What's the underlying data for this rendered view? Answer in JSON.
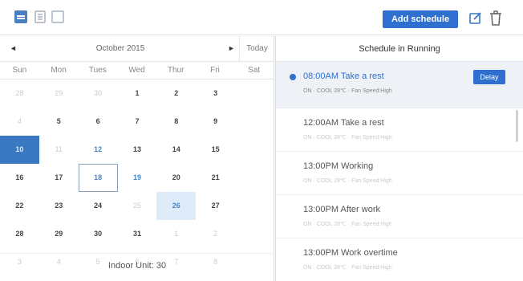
{
  "toolbar": {
    "icons": [
      "calendar-view-icon",
      "list-view-icon",
      "grid-view-icon",
      "edit-icon",
      "trash-icon"
    ],
    "add_schedule_label": "Add schedule"
  },
  "calendar": {
    "prev_symbol": "◄",
    "month_title": "October 2015",
    "next_symbol": "►",
    "today_label": "Today",
    "weekdays": [
      "Sun",
      "Mon",
      "Tues",
      "Wed",
      "Thur",
      "Fri",
      "Sat"
    ],
    "days": [
      {
        "n": "28",
        "other": true
      },
      {
        "n": "29",
        "other": true
      },
      {
        "n": "30",
        "other": true
      },
      {
        "n": "1"
      },
      {
        "n": "2"
      },
      {
        "n": "3"
      },
      {
        "n": "4",
        "other": true
      },
      {
        "n": "5"
      },
      {
        "n": "6"
      },
      {
        "n": "7"
      },
      {
        "n": "8"
      },
      {
        "n": "9"
      },
      {
        "n": "10",
        "selected": true
      },
      {
        "n": "11",
        "other": true
      },
      {
        "n": "12",
        "weekend": true
      },
      {
        "n": "13"
      },
      {
        "n": "14"
      },
      {
        "n": "15"
      },
      {
        "n": "16"
      },
      {
        "n": "17"
      },
      {
        "n": "18",
        "weekend": true,
        "today": true
      },
      {
        "n": "19",
        "weekend": true
      },
      {
        "n": "20"
      },
      {
        "n": "21"
      },
      {
        "n": "22"
      },
      {
        "n": "23"
      },
      {
        "n": "24"
      },
      {
        "n": "25",
        "other": true
      },
      {
        "n": "26",
        "highlight": true
      },
      {
        "n": "27"
      },
      {
        "n": "28"
      },
      {
        "n": "29"
      },
      {
        "n": "30"
      },
      {
        "n": "31"
      },
      {
        "n": "1",
        "other": true
      },
      {
        "n": "2",
        "other": true
      },
      {
        "n": "3",
        "other": true
      },
      {
        "n": "4",
        "other": true
      },
      {
        "n": "5",
        "other": true
      },
      {
        "n": "6",
        "other": true
      },
      {
        "n": "7",
        "other": true
      },
      {
        "n": "8",
        "other": true
      }
    ],
    "indoor_unit_label": "Indoor Unit: 30"
  },
  "schedule": {
    "title": "Schedule in Running",
    "delay_label": "Delay",
    "items": [
      {
        "time": "08:00AM Take a rest",
        "detail": "ON · COOL 28℃ · Fan Speed:High",
        "active": true
      },
      {
        "time": "12:00AM Take a rest",
        "detail": "ON · COOL 28℃ · Fan Speed:High"
      },
      {
        "time": "13:00PM Working",
        "detail": "ON · COOL 28℃ · Fan Speed:High"
      },
      {
        "time": "13:00PM After work",
        "detail": "ON · COOL 28℃ · Fan Speed:High"
      },
      {
        "time": "13:00PM Work overtime",
        "detail": "ON · COOL 28℃ · Fan Speed:High"
      }
    ]
  },
  "colors": {
    "accent": "#2e6fd0",
    "selected_day": "#3a78c2",
    "highlight_day": "#ddecf8",
    "weekend_text": "#4a86c6"
  }
}
